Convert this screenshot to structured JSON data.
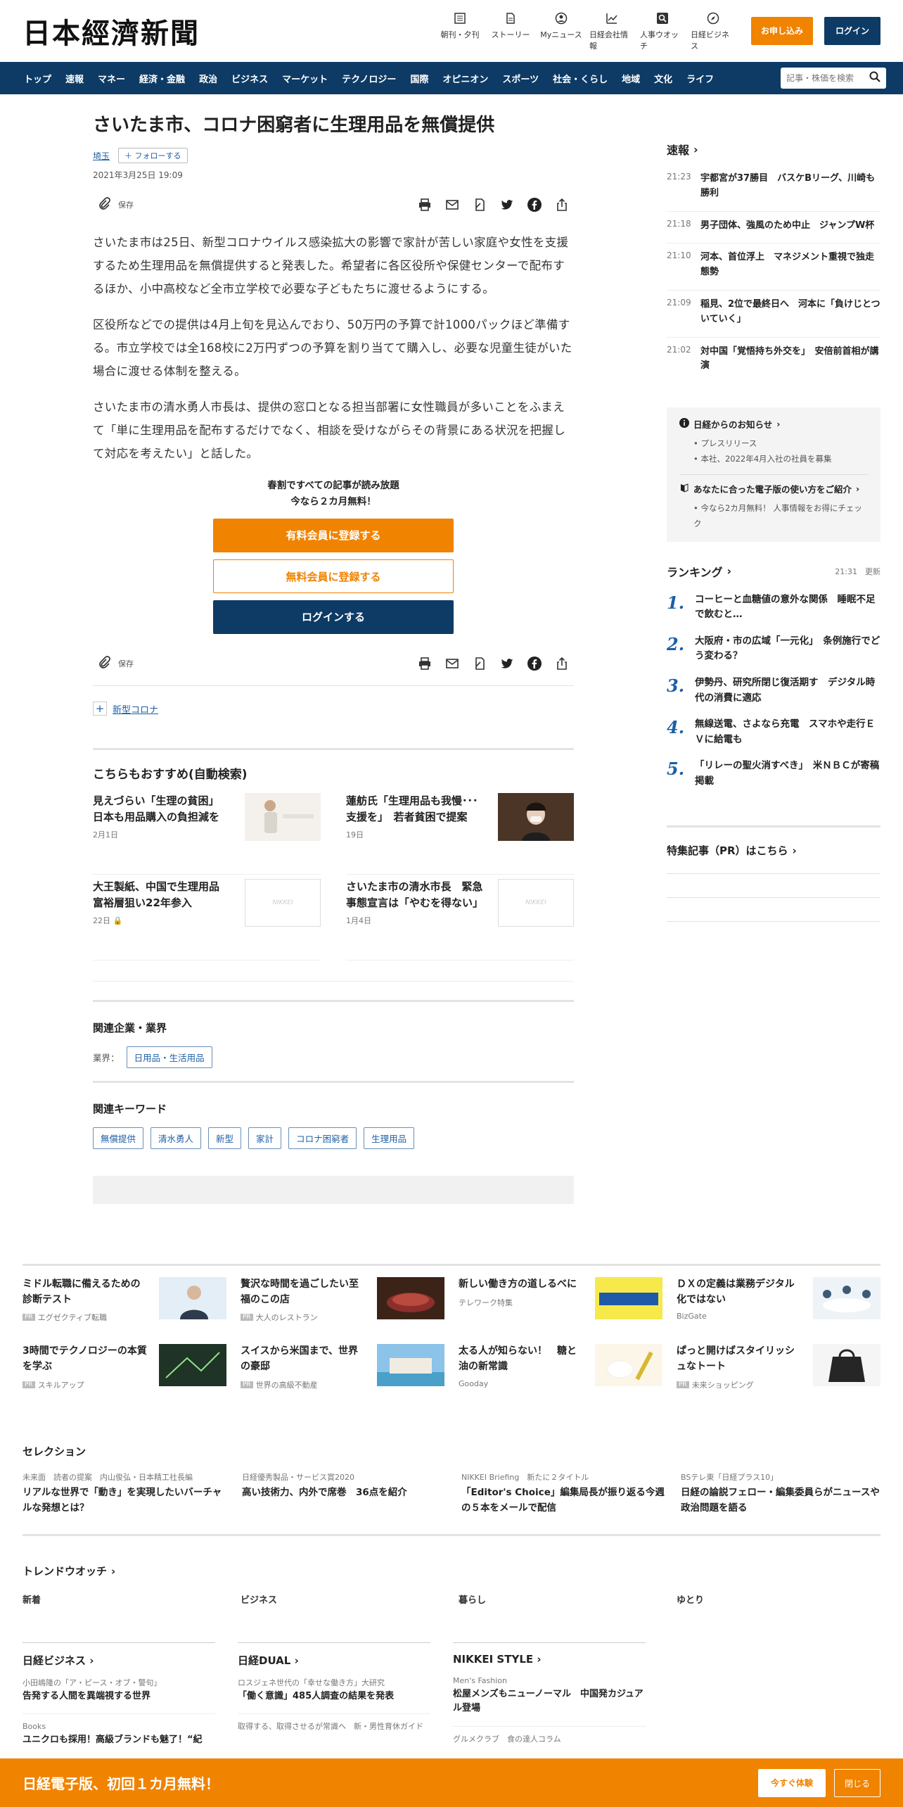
{
  "header": {
    "logo": "日本經濟新聞",
    "nav": [
      {
        "label": "朝刊・夕刊",
        "icon": "newspaper-icon"
      },
      {
        "label": "ストーリー",
        "icon": "story-icon"
      },
      {
        "label": "Myニュース",
        "icon": "user-icon"
      },
      {
        "label": "日経会社情報",
        "icon": "chart-icon"
      },
      {
        "label": "人事ウオッチ",
        "icon": "search-person-icon"
      },
      {
        "label": "日経ビジネス",
        "icon": "compass-icon"
      }
    ],
    "subscribe": "お申し込み",
    "login": "ログイン"
  },
  "menu": {
    "items": [
      "トップ",
      "速報",
      "マネー",
      "経済・金融",
      "政治",
      "ビジネス",
      "マーケット",
      "テクノロジー",
      "国際",
      "オピニオン",
      "スポーツ",
      "社会・くらし",
      "地域",
      "文化",
      "ライフ"
    ],
    "search_placeholder": "記事・株価を検索"
  },
  "article": {
    "title": "さいたま市、コロナ困窮者に生理用品を無償提供",
    "region": "埼玉",
    "follow": "フォローする",
    "date": "2021年3月25日 19:09",
    "save": "保存",
    "paragraphs": [
      "さいたま市は25日、新型コロナウイルス感染拡大の影響で家計が苦しい家庭や女性を支援するため生理用品を無償提供すると発表した。希望者に各区役所や保健センターで配布するほか、小中高校など全市立学校で必要な子どもたちに渡せるようにする。",
      "区役所などでの提供は4月上旬を見込んでおり、50万円の予算で計1000パックほど準備する。市立学校では全168校に2万円ずつの予算を割り当てて購入し、必要な児童生徒がいた場合に渡せる体制を整える。",
      "さいたま市の清水勇人市長は、提供の窓口となる担当部署に女性職員が多いことをふまえて「単に生理用品を配布するだけでなく、相談を受けながらその背景にある状況を把握して対応を考えたい」と話した。"
    ]
  },
  "paywall": {
    "line1": "春割ですべての記事が読み放題",
    "line2": "今なら２カ月無料！",
    "paid": "有料会員に登録する",
    "free": "無料会員に登録する",
    "login": "ログインする"
  },
  "topic": "新型コロナ",
  "recommend": {
    "heading": "こちらもおすすめ(自動検索)",
    "items": [
      {
        "title": "見えづらい「生理の貧困」　日本も用品購入の負担減を",
        "date": "2月1日"
      },
      {
        "title": "蓮舫氏「生理用品も我慢･･･支援を」　若者貧困で提案",
        "date": "19日"
      },
      {
        "title": "大王製紙、中国で生理用品　富裕層狙い22年参入",
        "date": "22日"
      },
      {
        "title": "さいたま市の清水市長　緊急事態宣言は「やむを得ない」",
        "date": "1月4日"
      }
    ],
    "placeholder_logo": "NIKKEI"
  },
  "related": {
    "companies_heading": "関連企業・業界",
    "industry_label": "業界：",
    "industry": "日用品・生活用品",
    "keywords_heading": "関連キーワード",
    "keywords": [
      "無償提供",
      "清水勇人",
      "新型",
      "家計",
      "コロナ困窮者",
      "生理用品"
    ]
  },
  "sidebar": {
    "breaking_heading": "速報",
    "breaking": [
      {
        "time": "21:23",
        "title": "宇都宮が37勝目　バスケBリーグ、川崎も勝利"
      },
      {
        "time": "21:18",
        "title": "男子団体、強風のため中止　ジャンプW杯"
      },
      {
        "time": "21:10",
        "title": "河本、首位浮上　マネジメント重視で独走態勢"
      },
      {
        "time": "21:09",
        "title": "稲見、2位で最終日へ　河本に「負けじとついていく」"
      },
      {
        "time": "21:02",
        "title": "対中国「覚悟持ち外交を」　安倍前首相が講演"
      }
    ],
    "notice_heading": "日経からのお知らせ",
    "notices": [
      "プレスリリース",
      "本社、2022年4月入社の社員を募集"
    ],
    "digital_heading": "あなたに合った電子版の使い方をご紹介",
    "digital_items": [
      "今なら2カ月無料！ 人事情報をお得にチェック"
    ],
    "ranking_heading": "ランキング",
    "ranking_time": "21:31　更新",
    "ranking": [
      "コーヒーと血糖値の意外な関係　睡眠不足で飲むと…",
      "大阪府・市の広域「一元化」　条例施行でどう変わる？",
      "伊勢丹、研究所閉じ復活期す　デジタル時代の消費に適応",
      "無線送電、さよなら充電　スマホや走行ＥＶに給電も",
      "「リレーの聖火消すべき」　米ＮＢＣが寄稿掲載"
    ],
    "pr_link": "特集記事（PR）はこちら"
  },
  "pr_ads": [
    {
      "title": "ミドル転職に備えるための診断テスト",
      "src": "エグゼクティブ転職"
    },
    {
      "title": "贅沢な時間を過ごしたい至福のこの店",
      "src": "大人のレストラン"
    },
    {
      "title": "新しい働き方の道しるべに",
      "src": "テレワーク特集"
    },
    {
      "title": "ＤＸの定義は業務デジタル化ではない",
      "src": "BizGate"
    },
    {
      "title": "3時間でテクノロジーの本質を学ぶ",
      "src": "スキルアップ"
    },
    {
      "title": "スイスから米国まで、世界の豪邸",
      "src": "世界の高級不動産"
    },
    {
      "title": "太る人が知らない！　糖と油の新常識",
      "src": "Gooday"
    },
    {
      "title": "ぱっと開けばスタイリッシュなトート",
      "src": "未来ショッピング"
    }
  ],
  "pr_badge": "PR",
  "selection": {
    "heading": "セレクション",
    "items": [
      {
        "sub": "未来面　読者の提案　内山俊弘・日本精工社長編",
        "title": "リアルな世界で「動き」を実現したいバーチャルな発想とは？"
      },
      {
        "sub": "日経優秀製品・サービス賞2020",
        "title": "高い技術力、内外で席巻　36点を紹介"
      },
      {
        "sub": "NIKKEI Briefing　新たに２タイトル",
        "title": "「Editor's Choice」編集局長が振り返る今週の５本をメールで配信"
      },
      {
        "sub": "BSテレ東「日経プラス10」",
        "title": "日経の論説フェロー・編集委員らがニュースや政治問題を語る"
      }
    ]
  },
  "trend": {
    "heading": "トレンドウオッチ",
    "tabs": [
      "新着",
      "ビジネス",
      "暮らし",
      "ゆとり"
    ]
  },
  "media": [
    {
      "name": "日経ビジネス",
      "sub": "小田嶋隆の「ア・ピース・オブ・警句」",
      "title": "告発する人間を異端視する世界",
      "sub2": "Books",
      "title2": "ユニクロも採用！高級ブランドも魅了！“紀"
    },
    {
      "name": "日経DUAL",
      "sub": "ロスジェネ世代の「幸せな働き方」大研究",
      "title": "「働く意識」485人調査の結果を発表",
      "sub2": "取得する、取得させるが常識へ　新・男性育休ガイド",
      "title2": ""
    },
    {
      "name": "NIKKEI STYLE",
      "sub": "Men's Fashion",
      "title": "松屋メンズもニューノーマル　中国発カジュアル登場",
      "sub2": "グルメクラブ　食の達人コラム",
      "title2": ""
    }
  ],
  "banner": {
    "text": "日経電子版、初回１カ月無料！",
    "try": "今すぐ体験",
    "close": "閉じる"
  },
  "colors": {
    "navy": "#0d3b66",
    "orange": "#f08300",
    "link": "#1d5fa6"
  }
}
